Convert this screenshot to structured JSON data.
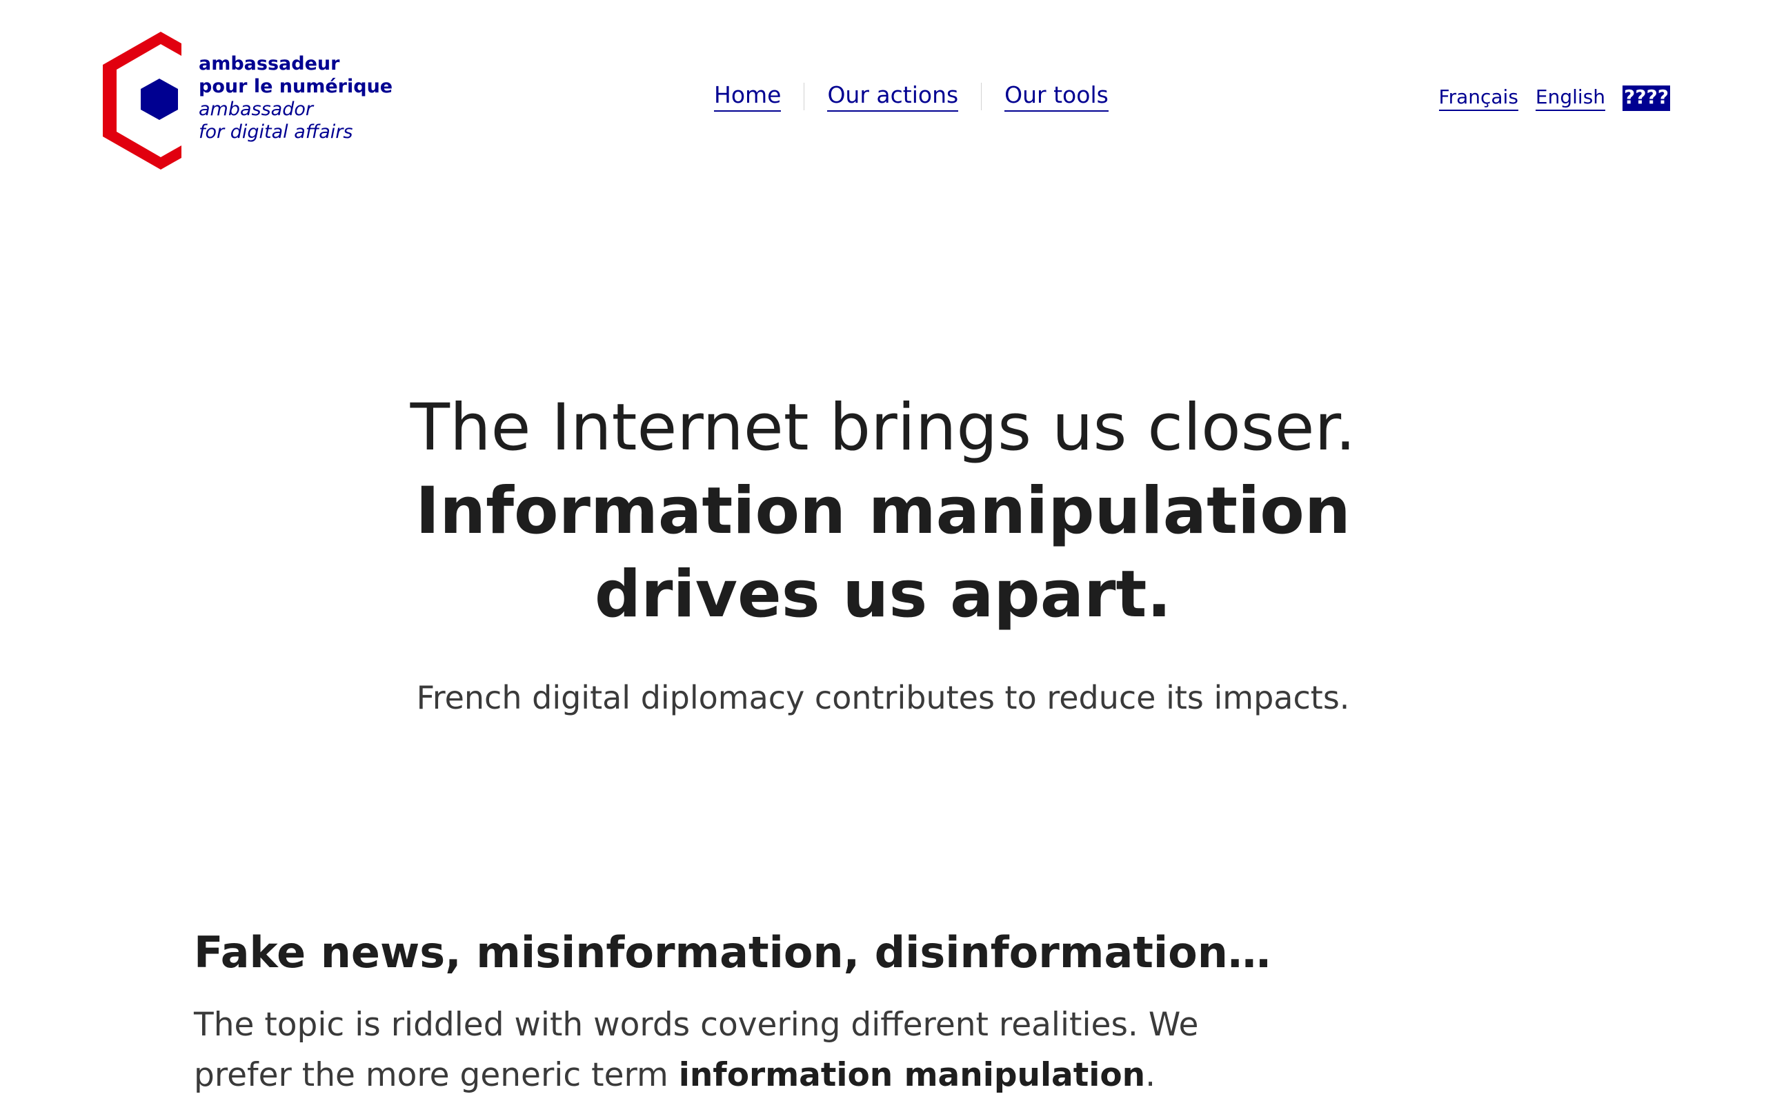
{
  "logo": {
    "line1": "ambassadeur",
    "line2": "pour le numérique",
    "line3": "ambassador",
    "line4": "for digital affairs",
    "icon": "hexagon-c-logo-icon",
    "colors": {
      "red": "#e1000f",
      "blue": "#000091"
    }
  },
  "nav": {
    "home": "Home",
    "actions": "Our actions",
    "tools": "Our tools"
  },
  "languages": {
    "fr": "Français",
    "en": "English",
    "other": "????"
  },
  "hero": {
    "line1": "The Internet brings us closer.",
    "line2": "Information manipulation",
    "line3": "drives us apart.",
    "subtitle": "French digital diplomacy contributes to reduce its impacts."
  },
  "section": {
    "title": "Fake news, misinformation, disinformation…",
    "text_before": "The topic is riddled with words covering different realities. We prefer the more generic term ",
    "text_bold": "information manipulation",
    "text_after": "."
  },
  "colors": {
    "accent": "#000091",
    "text": "#1e1e1e",
    "muted": "#3a3a3a"
  }
}
